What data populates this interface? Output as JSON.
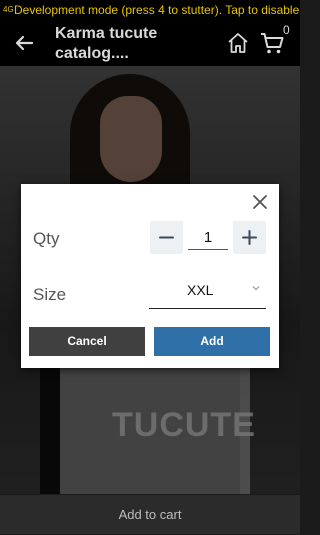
{
  "status_bar": {
    "carrier": "4G",
    "debug_text": "Development mode (press 4 to stutter). Tap to disable"
  },
  "header": {
    "title": "Karma tucute catalog....",
    "cart_count": "0",
    "icons": [
      "back-arrow-icon",
      "home-icon",
      "cart-icon"
    ]
  },
  "product": {
    "brand_watermark": "TUCUTE"
  },
  "dialog": {
    "qty_label": "Qty",
    "qty_value": "1",
    "size_label": "Size",
    "size_value": "XXL",
    "cancel_label": "Cancel",
    "add_label": "Add",
    "colors": {
      "cancel": "#404040",
      "add": "#2f70a9"
    }
  },
  "bottom_bar": {
    "add_to_cart_label": "Add to cart"
  }
}
